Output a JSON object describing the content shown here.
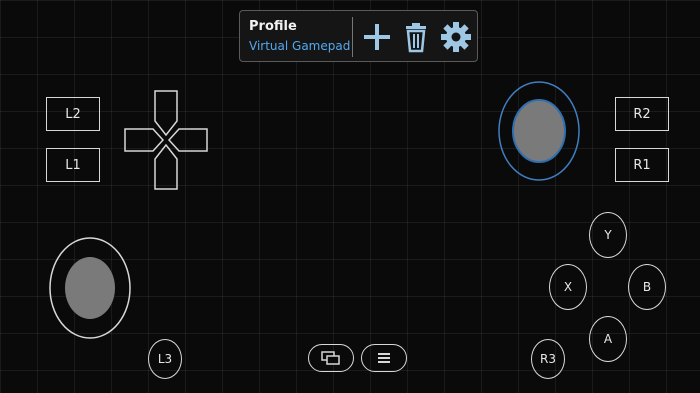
{
  "toolbar": {
    "profile_label": "Profile",
    "profile_name": "Virtual Gamepad",
    "icons": [
      "plus-icon",
      "trash-icon",
      "gear-icon"
    ]
  },
  "shoulder_buttons": {
    "l2": "L2",
    "l1": "L1",
    "r2": "R2",
    "r1": "R1"
  },
  "stick_buttons": {
    "l3": "L3",
    "r3": "R3"
  },
  "face_buttons": {
    "y": "Y",
    "x": "X",
    "b": "B",
    "a": "A"
  },
  "bottom_icons": [
    "windows-icon",
    "menu-icon"
  ],
  "colors": {
    "background": "#0a0a0a",
    "accent": "#53a9f0",
    "outline": "#d8d8d8",
    "stick_fill": "#7a7a7a"
  }
}
